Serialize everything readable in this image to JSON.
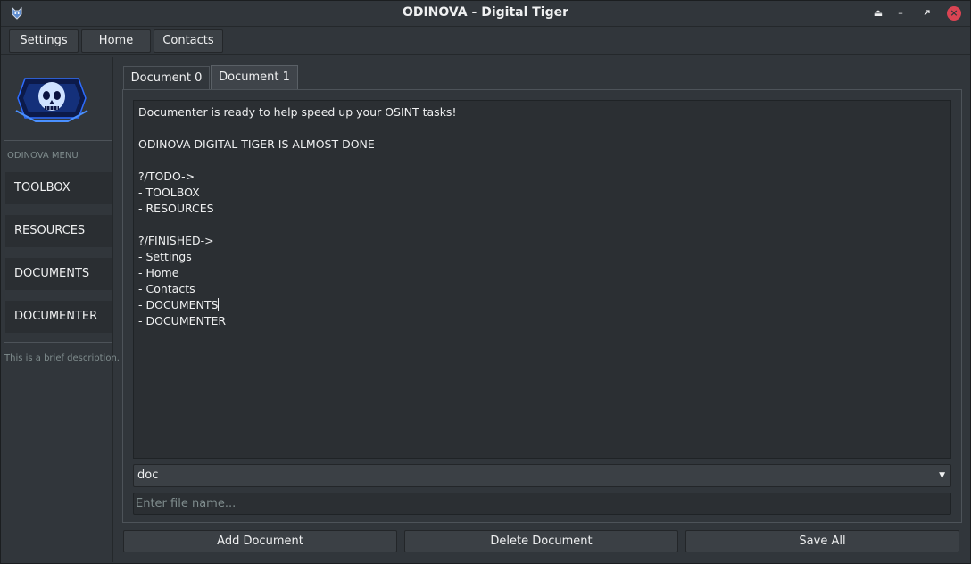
{
  "window": {
    "title": "ODINOVA - Digital Tiger",
    "app_icon": "tiger-logo-icon",
    "controls": [
      "shade-icon",
      "minimize-icon",
      "restore-icon",
      "close-icon"
    ]
  },
  "toolbar": {
    "items": [
      {
        "label": "Settings"
      },
      {
        "label": "Home"
      },
      {
        "label": "Contacts"
      }
    ]
  },
  "sidebar": {
    "logo": "odinova-skull-logo",
    "menu_title": "ODINOVA MENU",
    "items": [
      {
        "label": "TOOLBOX"
      },
      {
        "label": "RESOURCES"
      },
      {
        "label": "DOCUMENTS"
      },
      {
        "label": "DOCUMENTER"
      }
    ],
    "description": "This is a brief description."
  },
  "main": {
    "tabs": [
      {
        "label": "Document 0"
      },
      {
        "label": "Document 1"
      }
    ],
    "active_tab": 1,
    "editor_lines": [
      "Documenter is ready to help speed up your OSINT tasks!",
      "",
      "ODINOVA DIGITAL TIGER IS ALMOST DONE",
      "",
      "?/TODO->",
      "- TOOLBOX",
      "- RESOURCES",
      "",
      "?/FINISHED->",
      "- Settings",
      "- Home",
      "- Contacts",
      "- DOCUMENTS",
      "- DOCUMENTER"
    ],
    "format_select": {
      "value": "doc"
    },
    "filename_input": {
      "value": "",
      "placeholder": "Enter file name..."
    }
  },
  "bottom_buttons": {
    "add": "Add Document",
    "delete": "Delete Document",
    "save": "Save All"
  },
  "colors": {
    "background": "#31363b",
    "editor_bg": "#2b2f33",
    "button_bg": "#3b4045",
    "close_red": "#da4453",
    "text": "#eff0f1"
  }
}
